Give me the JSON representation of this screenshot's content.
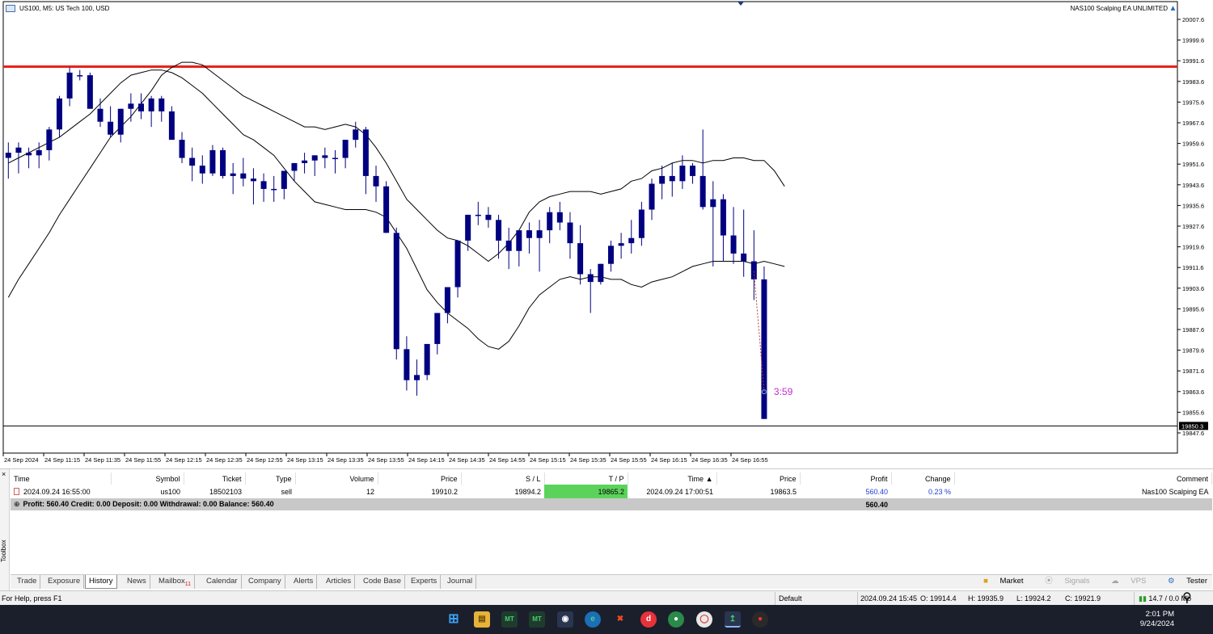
{
  "chart": {
    "title": "US100, M5:  US Tech 100, USD",
    "ea_name": "NAS100 Scalping EA UNLIMITED",
    "timer_label": "3:59",
    "current_price_label": "19850.3",
    "price_ticks": [
      "20007.6",
      "19999.6",
      "19991.6",
      "19983.6",
      "19975.6",
      "19967.6",
      "19959.6",
      "19951.6",
      "19943.6",
      "19935.6",
      "19927.6",
      "19919.6",
      "19911.6",
      "19903.6",
      "19895.6",
      "19887.6",
      "19879.6",
      "19871.6",
      "19863.6",
      "19855.6",
      "19847.6"
    ],
    "time_ticks": [
      "24 Sep 2024",
      "24 Sep 11:15",
      "24 Sep 11:35",
      "24 Sep 11:55",
      "24 Sep 12:15",
      "24 Sep 12:35",
      "24 Sep 12:55",
      "24 Sep 13:15",
      "24 Sep 13:35",
      "24 Sep 13:55",
      "24 Sep 14:15",
      "24 Sep 14:35",
      "24 Sep 14:55",
      "24 Sep 15:15",
      "24 Sep 15:35",
      "24 Sep 15:55",
      "24 Sep 16:15",
      "24 Sep 16:35",
      "24 Sep 16:55"
    ],
    "colors": {
      "candle": "#000080",
      "level_line": "#e8221b",
      "timer": "#c22fd0",
      "grid": "#e9f2ee"
    }
  },
  "chart_data": {
    "type": "candlestick",
    "ylim": [
      19847.6,
      20007.6
    ],
    "resistance_level": 19989.3,
    "current_price": 19850.3,
    "candles": [
      [
        19954,
        19960,
        19946,
        19956
      ],
      [
        19956,
        19960,
        19948,
        19958
      ],
      [
        19955,
        19958,
        19950,
        19956
      ],
      [
        19955,
        19960,
        19950,
        19957
      ],
      [
        19957,
        19966,
        19953,
        19965
      ],
      [
        19965,
        19978,
        19962,
        19977
      ],
      [
        19977,
        19989,
        19974,
        19987
      ],
      [
        19986,
        19988,
        19984,
        19986
      ],
      [
        19986,
        19987,
        19976,
        19973
      ],
      [
        19973,
        19977,
        19966,
        19968
      ],
      [
        19968,
        19974,
        19962,
        19963
      ],
      [
        19963,
        19973,
        19960,
        19973
      ],
      [
        19973,
        19979,
        19968,
        19975
      ],
      [
        19975,
        19979,
        19969,
        19972
      ],
      [
        19972,
        19978,
        19966,
        19977
      ],
      [
        19977,
        19978,
        19968,
        19972
      ],
      [
        19972,
        19974,
        19962,
        19961
      ],
      [
        19961,
        19964,
        19952,
        19954
      ],
      [
        19954,
        19958,
        19945,
        19951
      ],
      [
        19951,
        19955,
        19944,
        19948
      ],
      [
        19948,
        19959,
        19947,
        19957
      ],
      [
        19957,
        19958,
        19946,
        19947
      ],
      [
        19947,
        19952,
        19940,
        19948
      ],
      [
        19948,
        19954,
        19943,
        19946
      ],
      [
        19946,
        19950,
        19936,
        19945
      ],
      [
        19945,
        19948,
        19937,
        19942
      ],
      [
        19942,
        19947,
        19937,
        19942
      ],
      [
        19942,
        19949,
        19938,
        19949
      ],
      [
        19949,
        19952,
        19945,
        19952
      ],
      [
        19952,
        19956,
        19948,
        19953
      ],
      [
        19953,
        19955,
        19947,
        19955
      ],
      [
        19955,
        19958,
        19950,
        19954
      ],
      [
        19954,
        19957,
        19948,
        19954
      ],
      [
        19954,
        19961,
        19950,
        19961
      ],
      [
        19961,
        19968,
        19958,
        19965
      ],
      [
        19965,
        19966,
        19940,
        19947
      ],
      [
        19947,
        19951,
        19937,
        19943
      ],
      [
        19943,
        19945,
        19925,
        19925
      ],
      [
        19925,
        19927,
        19876,
        19880
      ],
      [
        19880,
        19885,
        19864,
        19868
      ],
      [
        19868,
        19876,
        19862,
        19870
      ],
      [
        19870,
        19882,
        19868,
        19882
      ],
      [
        19882,
        19894,
        19878,
        19894
      ],
      [
        19894,
        19904,
        19890,
        19904
      ],
      [
        19904,
        19922,
        19900,
        19922
      ],
      [
        19922,
        19932,
        19918,
        19932
      ],
      [
        19932,
        19937,
        19928,
        19932
      ],
      [
        19932,
        19935,
        19927,
        19930
      ],
      [
        19930,
        19932,
        19915,
        19922
      ],
      [
        19922,
        19927,
        19911,
        19918
      ],
      [
        19918,
        19926,
        19912,
        19926
      ],
      [
        19926,
        19929,
        19917,
        19923
      ],
      [
        19923,
        19930,
        19910,
        19926
      ],
      [
        19926,
        19935,
        19921,
        19933
      ],
      [
        19933,
        19937,
        19926,
        19929
      ],
      [
        19929,
        19933,
        19915,
        19921
      ],
      [
        19921,
        19928,
        19905,
        19909
      ],
      [
        19909,
        19911,
        19894,
        19906
      ],
      [
        19906,
        19913,
        19905,
        19913
      ],
      [
        19913,
        19922,
        19910,
        19920
      ],
      [
        19920,
        19925,
        19915,
        19921
      ],
      [
        19921,
        19930,
        19917,
        19923
      ],
      [
        19923,
        19937,
        19920,
        19934
      ],
      [
        19934,
        19946,
        19930,
        19944
      ],
      [
        19944,
        19951,
        19938,
        19947
      ],
      [
        19947,
        19952,
        19939,
        19945
      ],
      [
        19945,
        19955,
        19942,
        19951
      ],
      [
        19951,
        19952,
        19944,
        19947
      ],
      [
        19947,
        19965,
        19934,
        19935
      ],
      [
        19935,
        19945,
        19912,
        19938
      ],
      [
        19938,
        19940,
        19914,
        19924
      ],
      [
        19924,
        19935,
        19913,
        19917
      ],
      [
        19917,
        19934,
        19908,
        19914
      ],
      [
        19914,
        19926,
        19899,
        19907
      ],
      [
        19907,
        19912,
        19853,
        19853
      ]
    ],
    "upper_band": [
      19900,
      19907,
      19913,
      19919,
      19925,
      19932,
      19938,
      19944,
      19950,
      19956,
      19962,
      19966,
      19970,
      19975,
      19980,
      19986,
      19989,
      19991,
      19991,
      19990,
      19987,
      19984,
      19981,
      19978,
      19976,
      19974,
      19972,
      19970,
      19968,
      19966,
      19966,
      19965,
      19966,
      19967,
      19966,
      19963,
      19958,
      19952,
      19945,
      19938,
      19934,
      19930,
      19926,
      19923,
      19922,
      19920,
      19917,
      19914,
      19917,
      19921,
      19926,
      19933,
      19937,
      19939,
      19940,
      19941,
      19941,
      19941,
      19940,
      19941,
      19942,
      19945,
      19946,
      19949,
      19950,
      19952,
      19953,
      19953,
      19952,
      19953,
      19953,
      19954,
      19954,
      19953,
      19953,
      19949,
      19943
    ],
    "lower_band": [
      19952,
      19954,
      19956,
      19958,
      19960,
      19962,
      19965,
      19968,
      19971,
      19975,
      19979,
      19983,
      19986,
      19987,
      19988,
      19988,
      19987,
      19985,
      19982,
      19979,
      19975,
      19971,
      19967,
      19963,
      19961,
      19958,
      19955,
      19950,
      19945,
      19941,
      19937,
      19936,
      19935,
      19934,
      19934,
      19934,
      19933,
      19931,
      19925,
      19919,
      19911,
      19903,
      19898,
      19894,
      19891,
      19888,
      19884,
      19881,
      19880,
      19883,
      19889,
      19896,
      19901,
      19904,
      19907,
      19908,
      19907,
      19908,
      19908,
      19907,
      19907,
      19905,
      19904,
      19906,
      19907,
      19908,
      19910,
      19912,
      19913,
      19914,
      19914,
      19914,
      19914,
      19913,
      19914,
      19913,
      19912
    ]
  },
  "history": {
    "columns": [
      "Time",
      "Symbol",
      "Ticket",
      "Type",
      "Volume",
      "Price",
      "S / L",
      "T / P",
      "Time",
      "Price",
      "Profit",
      "Change",
      "Comment"
    ],
    "rows": [
      {
        "time": "2024.09.24 16:55:00",
        "symbol": "us100",
        "ticket": "18502103",
        "type": "sell",
        "volume": "12",
        "price": "19910.2",
        "sl": "19894.2",
        "tp": "19865.2",
        "time2": "2024.09.24 17:00:51",
        "price2": "19863.5",
        "profit": "560.40",
        "change": "0.23 %",
        "comment": "Nas100 Scalping EA"
      }
    ],
    "summary": "Profit: 560.40   Credit: 0.00   Deposit: 0.00   Withdrawal: 0.00   Balance: 560.40",
    "summary_profit": "560.40"
  },
  "toolbox": {
    "side_label": "Toolbox",
    "close": "×",
    "tabs": [
      "Trade",
      "Exposure",
      "History",
      "News",
      "Mailbox",
      "Calendar",
      "Company",
      "Alerts",
      "Articles",
      "Code Base",
      "Experts",
      "Journal"
    ],
    "mailbox_count": "11",
    "active_tab": "History",
    "right": {
      "market": "Market",
      "signals": "Signals",
      "vps": "VPS",
      "tester": "Tester"
    }
  },
  "status": {
    "help": "For Help, press F1",
    "profile": "Default",
    "datetime": "2024.09.24 15:45",
    "open": "O: 19914.4",
    "high": "H: 19935.9",
    "low": "L: 19924.2",
    "close": "C: 19921.9",
    "traffic": "14.7 / 0.0 Mb"
  },
  "taskbar": {
    "time": "2:01 PM",
    "date": "9/24/2024"
  }
}
